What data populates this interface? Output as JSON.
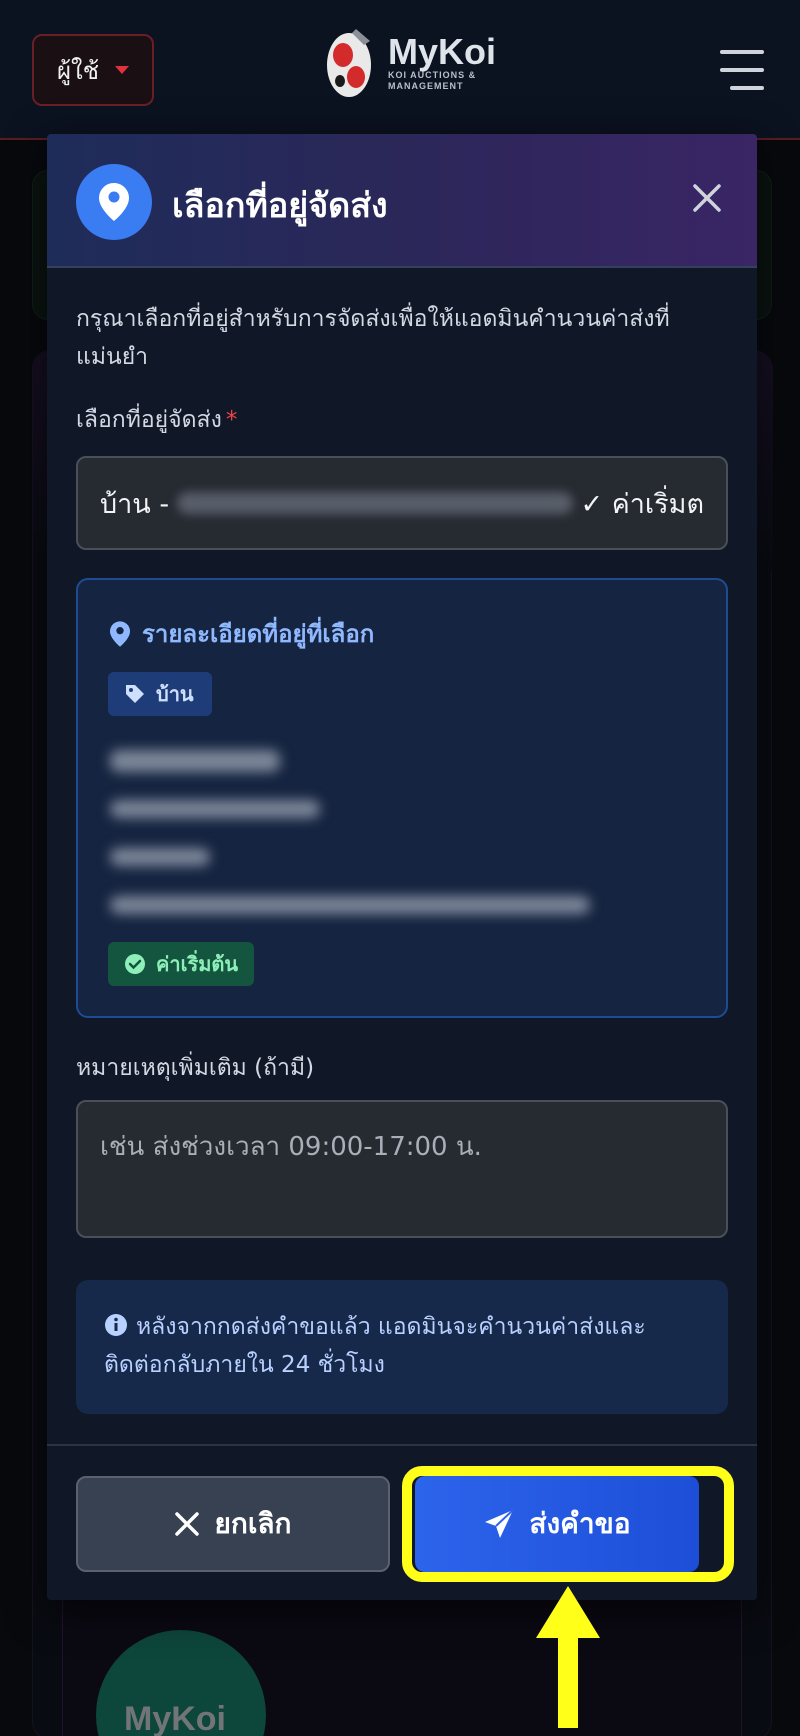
{
  "header": {
    "user_button_label": "ผู้ใช้",
    "logo": {
      "name": "MyKoi",
      "tagline_line1": "KOI AUCTIONS &",
      "tagline_line2": "MANAGEMENT"
    }
  },
  "modal": {
    "title": "เลือกที่อยู่จัดส่ง",
    "intro": "กรุณาเลือกที่อยู่สำหรับการจัดส่งเพื่อให้แอดมินคำนวนค่าส่งที่แม่นยำ",
    "address_field": {
      "label": "เลือกที่อยู่จัดส่ง",
      "required_marker": "*",
      "selected_prefix": "บ้าน -",
      "selected_suffix": "✓ ค่าเริ่มต"
    },
    "detail_card": {
      "title": "รายละเอียดที่อยู่ที่เลือก",
      "type_badge": "บ้าน",
      "default_badge": "ค่าเริ่มต้น"
    },
    "note_field": {
      "label": "หมายเหตุเพิ่มเติม (ถ้ามี)",
      "placeholder": "เช่น ส่งช่วงเวลา 09:00-17:00 น."
    },
    "info_text": "หลังจากกดส่งคำขอแล้ว แอดมินจะคำนวนค่าส่งและติดต่อกลับภายใน 24 ชั่วโมง",
    "buttons": {
      "cancel": "ยกเลิก",
      "send": "ส่งคำขอ"
    }
  },
  "background": {
    "footer_logo_text": "MyKoi"
  },
  "colors": {
    "accent_blue": "#2d64ec",
    "highlight_yellow": "#ffff1a",
    "danger_red": "#ef4444",
    "success_green": "#8ef0b8"
  },
  "icons": [
    "caret-down-icon",
    "hamburger-menu-icon",
    "map-pin-icon",
    "close-icon",
    "tag-icon",
    "check-circle-icon",
    "info-icon",
    "x-icon",
    "send-icon",
    "arrow-up-icon"
  ]
}
